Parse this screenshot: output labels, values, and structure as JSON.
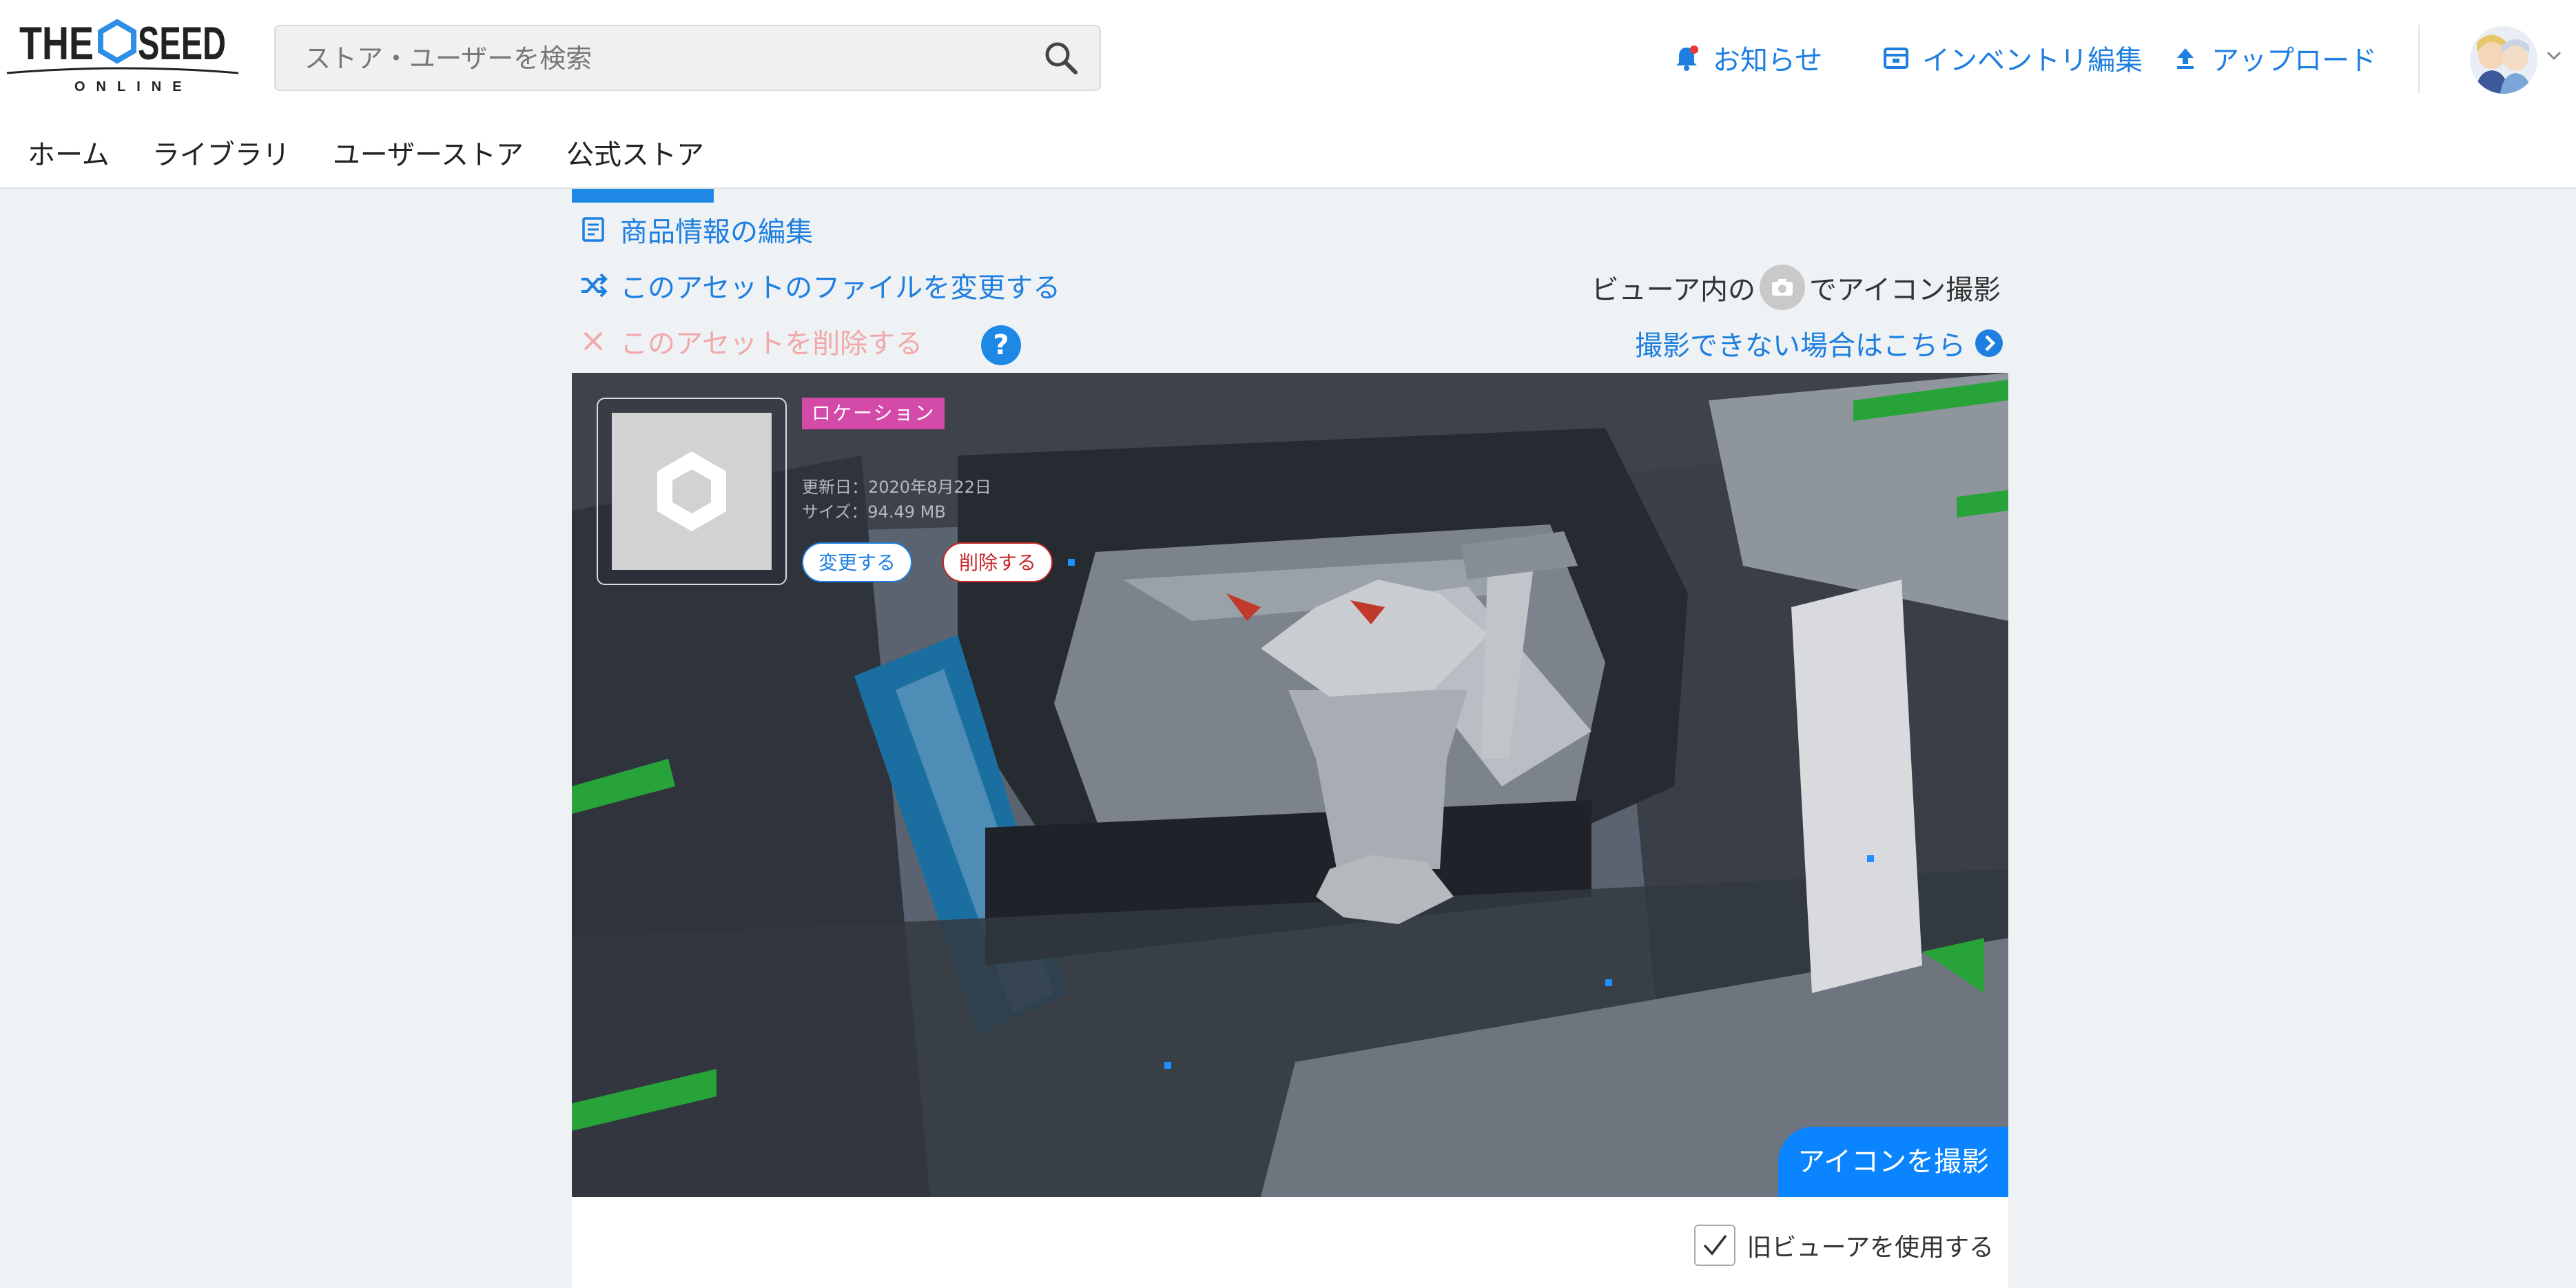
{
  "header": {
    "logo_text": "THE SEED",
    "logo_subtext": "ONLINE",
    "search_placeholder": "ストア・ユーザーを検索",
    "links": {
      "notifications": "お知らせ",
      "inventory": "インベントリ編集",
      "upload": "アップロード"
    }
  },
  "nav": [
    "ホーム",
    "ライブラリ",
    "ユーザーストア",
    "公式ストア"
  ],
  "actions": {
    "edit_info": "商品情報の編集",
    "change_file": "このアセットのファイルを変更する",
    "delete_asset": "このアセットを削除する",
    "help": "?"
  },
  "capture": {
    "hint_before": "ビューア内の",
    "hint_after": "でアイコン撮影",
    "help_link": "撮影できない場合はこちら"
  },
  "viewer": {
    "category_badge": "ロケーション",
    "updated": "更新日：2020年8月22日",
    "size": "サイズ：94.49 MB",
    "change_button": "変更する",
    "delete_button": "削除する",
    "capture_button": "アイコンを撮影",
    "old_viewer_label": "旧ビューアを使用する",
    "old_viewer_checked": true
  },
  "colors": {
    "link_blue": "#1e7fe0",
    "primary_blue": "#0a84ff",
    "badge_pink": "#d44aa8",
    "danger_red": "#c62828",
    "disabled_red": "#f2a8a8"
  }
}
